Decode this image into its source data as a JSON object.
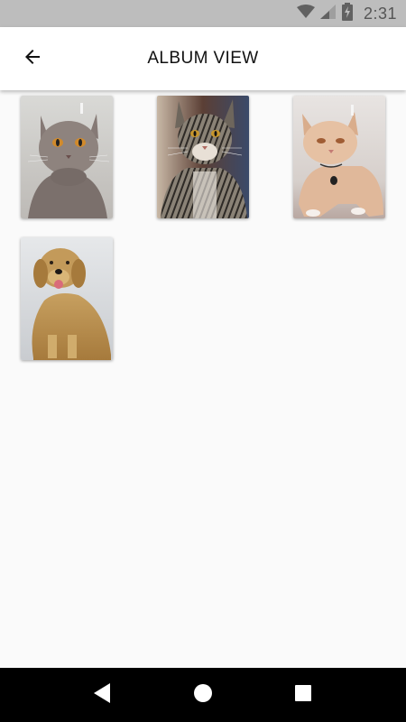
{
  "status_bar": {
    "time": "2:31",
    "icons": [
      "wifi-icon",
      "cell-signal-icon",
      "battery-charging-icon"
    ]
  },
  "app_bar": {
    "title": "ALBUM VIEW",
    "back_icon": "arrow-back-icon"
  },
  "album": {
    "photos": [
      {
        "subject": "gray-cat-photo"
      },
      {
        "subject": "tabby-cat-photo"
      },
      {
        "subject": "cream-cat-photo"
      },
      {
        "subject": "golden-retriever-photo"
      }
    ]
  },
  "nav_bar": {
    "buttons": [
      "back-triangle-icon",
      "home-circle-icon",
      "recents-square-icon"
    ]
  },
  "colors": {
    "status_bar": "#bdbdbd",
    "app_bar": "#ffffff",
    "background": "#fafafa",
    "nav_bar": "#000000"
  }
}
